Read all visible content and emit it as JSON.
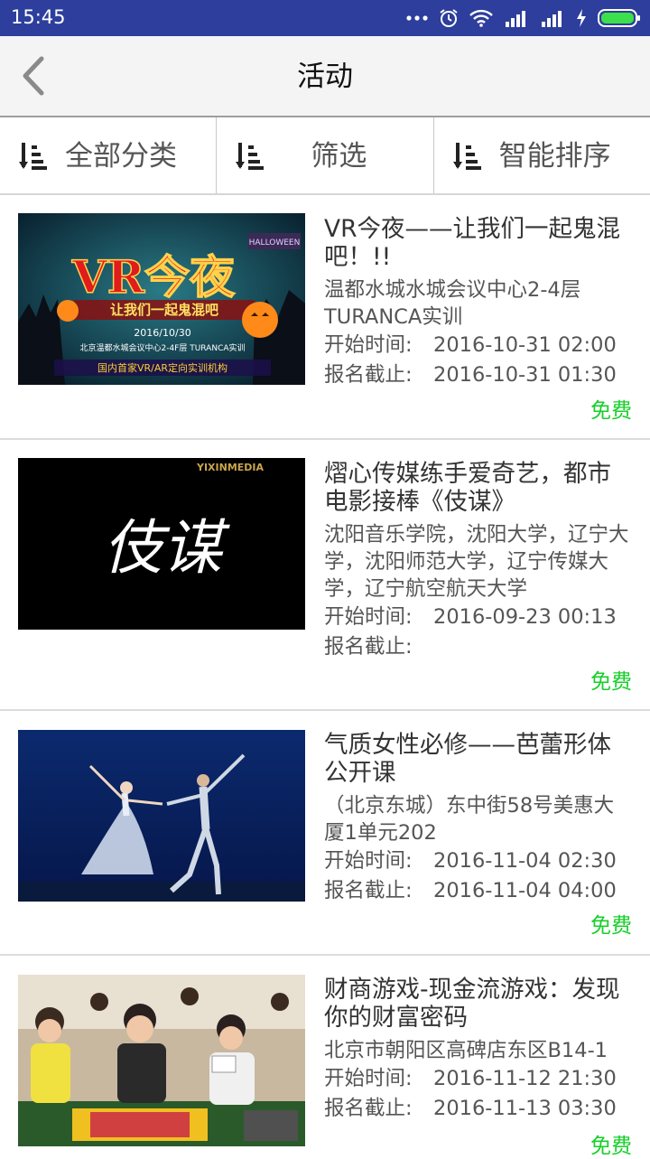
{
  "status_bar": {
    "time": "15:45"
  },
  "header": {
    "title": "活动"
  },
  "filters": [
    {
      "label": "全部分类"
    },
    {
      "label": "筛选"
    },
    {
      "label": "智能排序"
    }
  ],
  "labels": {
    "start": "开始时间:",
    "deadline": "报名截止:"
  },
  "events": [
    {
      "title": "VR今夜——让我们一起鬼混吧！!!",
      "location": "温都水城水城会议中心2-4层TURANCA实训",
      "start": "2016-10-31 02:00",
      "deadline": "2016-10-31 01:30",
      "price": "免费",
      "poster": {
        "headline": "VR今夜",
        "tagline": "让我们一起鬼混吧",
        "date": "2016/10/30",
        "venue": "北京温都水城会议中心2-4F层 TURANCA实训",
        "org": "国内首家VR/AR定向实训机构",
        "badge": "HALLOWEEN"
      }
    },
    {
      "title": "熠心传媒练手爱奇艺，都市电影接棒《伎谋》",
      "location": "沈阳音乐学院，沈阳大学，辽宁大学，沈阳师范大学，辽宁传媒大学，辽宁航空航天大学",
      "start": "2016-09-23 00:13",
      "deadline": "",
      "price": "免费",
      "poster": {
        "headline": "伎谋",
        "brand": "YIXINMEDIA"
      }
    },
    {
      "title": "气质女性必修——芭蕾形体公开课",
      "location": "（北京东城）东中街58号美惠大厦1单元202",
      "start": "2016-11-04 02:30",
      "deadline": "2016-11-04 04:00",
      "price": "免费"
    },
    {
      "title": "财商游戏-现金流游戏：发现你的财富密码",
      "location": "北京市朝阳区高碑店东区B14-1",
      "start": "2016-11-12 21:30",
      "deadline": "2016-11-13 03:30",
      "price": "免费"
    }
  ],
  "colors": {
    "status_bar": "#2d3e9c",
    "price": "#17cf2a",
    "nav_bg": "#f4f4f4"
  }
}
